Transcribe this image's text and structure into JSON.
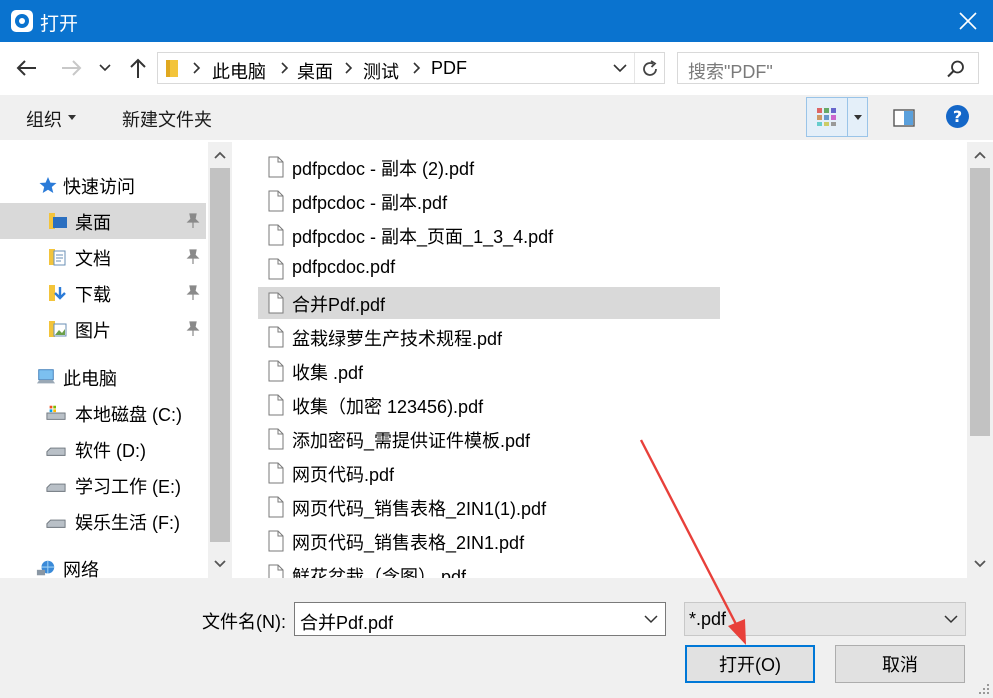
{
  "window": {
    "title": "打开"
  },
  "address": {
    "crumbs": [
      "此电脑",
      "桌面",
      "测试",
      "PDF"
    ],
    "search_placeholder": "搜索\"PDF\""
  },
  "toolbar": {
    "organize": "组织",
    "new_folder": "新建文件夹"
  },
  "nav": {
    "quick_access": "快速访问",
    "quick_items": [
      "桌面",
      "文档",
      "下载",
      "图片"
    ],
    "this_pc": "此电脑",
    "drives": [
      "本地磁盘 (C:)",
      "软件 (D:)",
      "学习工作 (E:)",
      "娱乐生活 (F:)"
    ],
    "network": "网络"
  },
  "files": [
    "pdfpcdoc - 副本 (2).pdf",
    "pdfpcdoc - 副本.pdf",
    "pdfpcdoc - 副本_页面_1_3_4.pdf",
    "pdfpcdoc.pdf",
    "合并Pdf.pdf",
    "盆栽绿萝生产技术规程.pdf",
    "收集 .pdf",
    "收集（加密 123456).pdf",
    "添加密码_需提供证件模板.pdf",
    "网页代码.pdf",
    "网页代码_销售表格_2IN1(1).pdf",
    "网页代码_销售表格_2IN1.pdf",
    "鲜花盆栽（含图）.pdf"
  ],
  "selected_file_index": 4,
  "bottom": {
    "filename_label": "文件名(N):",
    "filename_value": "合并Pdf.pdf",
    "filter_value": "*.pdf",
    "open_label": "打开(O)",
    "cancel_label": "取消"
  },
  "colors": {
    "titlebar": "#0a73cf",
    "selection": "#d9d9d9",
    "focus": "#0078d7",
    "annotation_arrow": "#e8403a"
  }
}
